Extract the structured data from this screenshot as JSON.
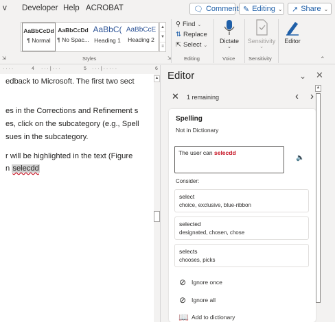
{
  "ribbon": {
    "tabs": [
      "v",
      "Developer",
      "Help",
      "ACROBAT"
    ],
    "comments_label": "Comments",
    "editing_label": "Editing",
    "share_label": "Share",
    "styles": [
      {
        "sample": "AaBbCcDd",
        "name": "¶ Normal"
      },
      {
        "sample": "AaBbCcDd",
        "name": "¶ No Spac..."
      },
      {
        "sample": "AaBbC(",
        "name": "Heading 1"
      },
      {
        "sample": "AaBbCcE",
        "name": "Heading 2"
      }
    ],
    "styles_group_label": "Styles",
    "find_label": "Find",
    "replace_label": "Replace",
    "select_label": "Select",
    "editing_group_label": "Editing",
    "dictate_label": "Dictate",
    "voice_group_label": "Voice",
    "sensitivity_label": "Sensitivity",
    "sensitivity_group_label": "Sensitivity",
    "editor_label": "Editor",
    "accent_color": "#1f5fa8"
  },
  "ruler": {
    "ticks": [
      "4",
      "5",
      "6"
    ]
  },
  "document": {
    "lines": [
      "edback to Microsoft. The first two sect",
      "es in the Corrections and Refinement s",
      "es, click on the subcategory (e.g., Spell",
      "sues in the subcategory.",
      "r will be highlighted in the text (Figure"
    ],
    "last_line_prefix": "n",
    "misspelled_word": "selecdd"
  },
  "editor_pane": {
    "title": "Editor",
    "remaining_text": "1 remaining",
    "card_heading": "Spelling",
    "card_sub": "Not in Dictionary",
    "context_prefix": "The user can ",
    "context_error": "selecdd",
    "consider_label": "Consider:",
    "suggestions": [
      {
        "word": "select",
        "synonyms": "choice, exclusive, blue-ribbon"
      },
      {
        "word": "selected",
        "synonyms": "designated, chosen, chose"
      },
      {
        "word": "selects",
        "synonyms": "chooses, picks"
      }
    ],
    "actions": {
      "ignore_once": "Ignore once",
      "ignore_all": "Ignore all",
      "add_to_dictionary": "Add to dictionary"
    },
    "error_color": "#c50f1f"
  }
}
